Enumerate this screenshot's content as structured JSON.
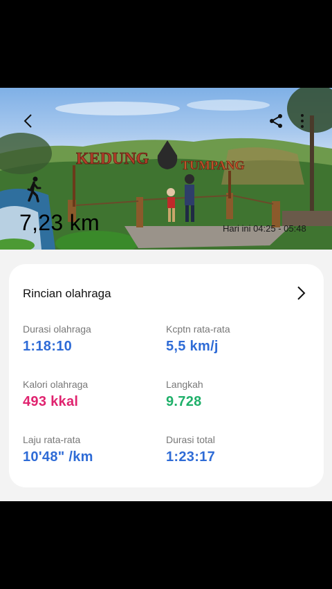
{
  "hero": {
    "distance": "7,23 km",
    "timestamp": "Hari ini 04:25 - 05:48",
    "sign_text": [
      "KEDUNG",
      "TUMPANG"
    ]
  },
  "nav": {
    "back_icon": "chevron-left-icon",
    "share_icon": "share-icon",
    "more_icon": "more-vertical-icon"
  },
  "details": {
    "title": "Rincian olahraga",
    "stats": [
      {
        "label": "Durasi olahraga",
        "value": "1:18:10",
        "color": "#2e6bd6"
      },
      {
        "label": "Kcptn rata-rata",
        "value": "5,5 km/j",
        "color": "#2e6bd6"
      },
      {
        "label": "Kalori olahraga",
        "value": "493 kkal",
        "color": "#e0236f"
      },
      {
        "label": "Langkah",
        "value": "9.728",
        "color": "#1fb06a"
      },
      {
        "label": "Laju rata-rata",
        "value": "10'48\" /km",
        "color": "#2e6bd6"
      },
      {
        "label": "Durasi total",
        "value": "1:23:17",
        "color": "#2e6bd6"
      }
    ]
  }
}
